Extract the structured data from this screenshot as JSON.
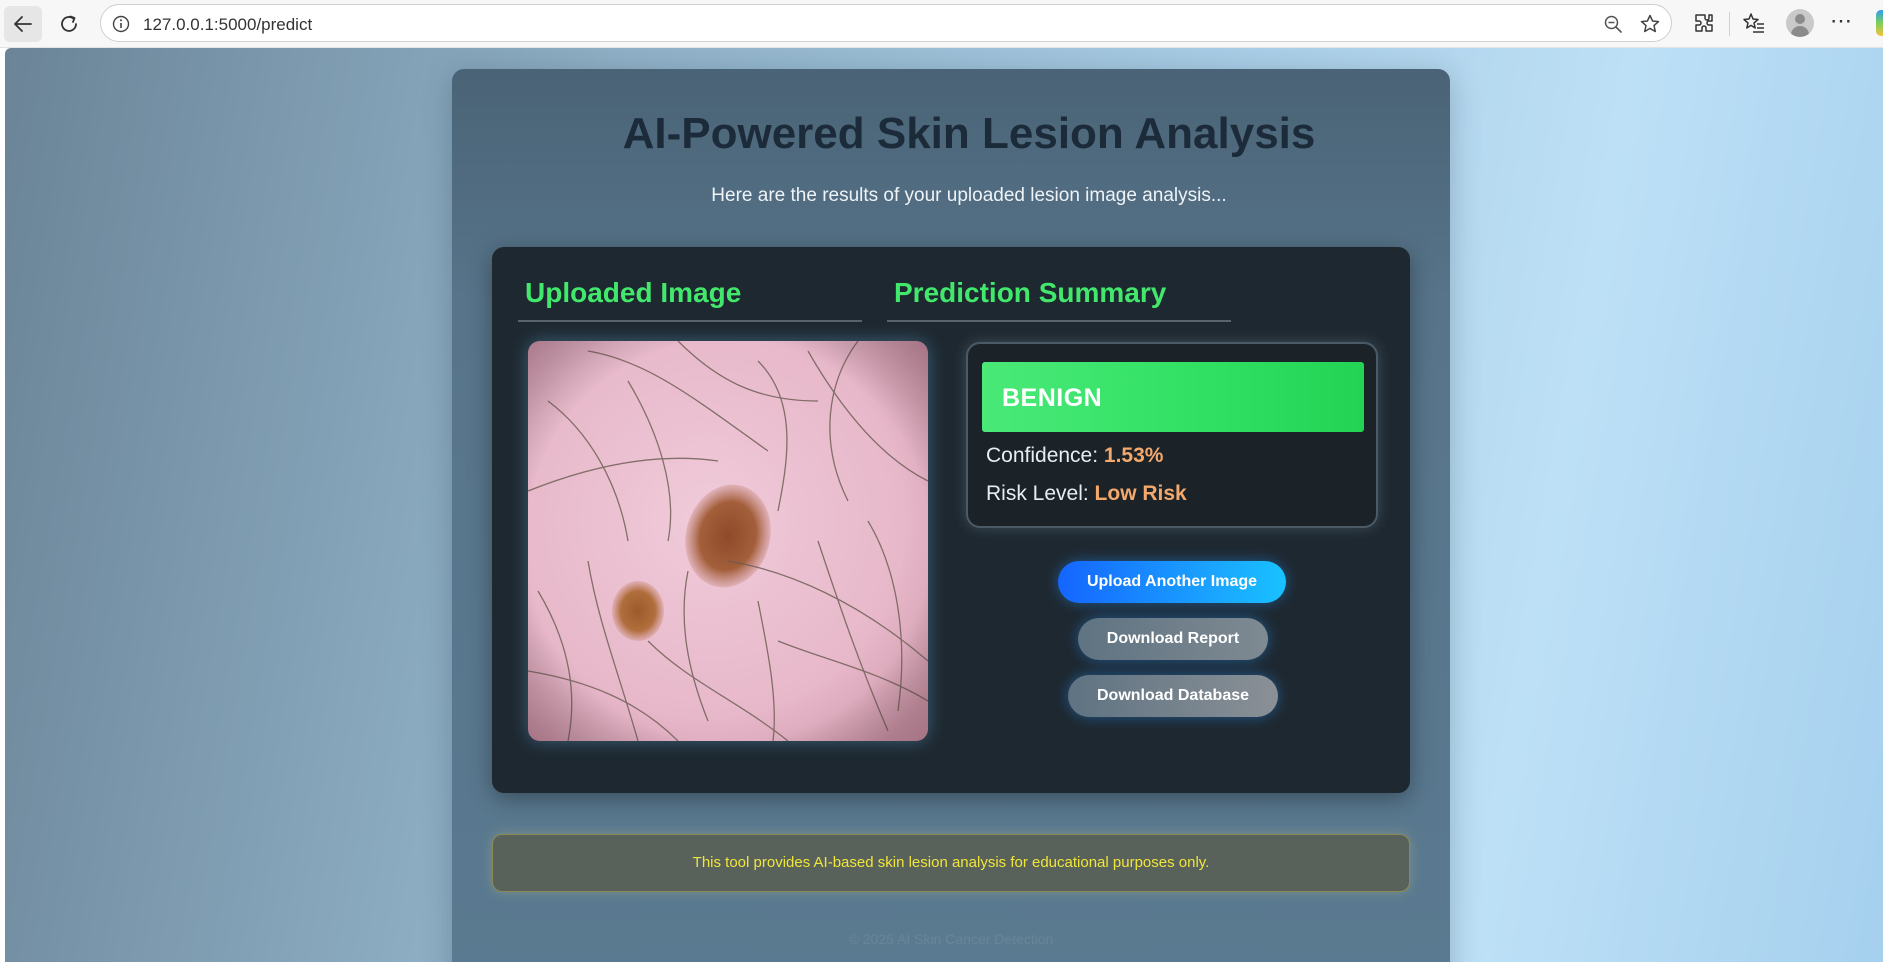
{
  "browser": {
    "url": "127.0.0.1:5000/predict"
  },
  "page": {
    "title": "AI-Powered Skin Lesion Analysis",
    "subtitle": "Here are the results of your uploaded lesion image analysis...",
    "uploaded_heading": "Uploaded Image",
    "summary_heading": "Prediction Summary",
    "prediction": "BENIGN",
    "confidence_label": "Confidence:",
    "confidence_value": "1.53%",
    "risk_label": "Risk Level:",
    "risk_value": "Low Risk",
    "buttons": {
      "upload": "Upload Another Image",
      "report": "Download Report",
      "database": "Download Database"
    },
    "disclaimer": "This tool provides AI-based skin lesion analysis for educational purposes only.",
    "footer": "© 2025 AI Skin Cancer Detection"
  },
  "colors": {
    "heading_accent": "#42e86c",
    "prediction_banner": "#2fe062",
    "stat_value": "#f4a86b",
    "disclaimer_text": "#f0e53a"
  },
  "icons": [
    "back-arrow-icon",
    "reload-icon",
    "info-icon",
    "zoom-out-icon",
    "favorite-star-icon",
    "extensions-icon",
    "favorites-icon",
    "profile-icon",
    "more-icon"
  ]
}
